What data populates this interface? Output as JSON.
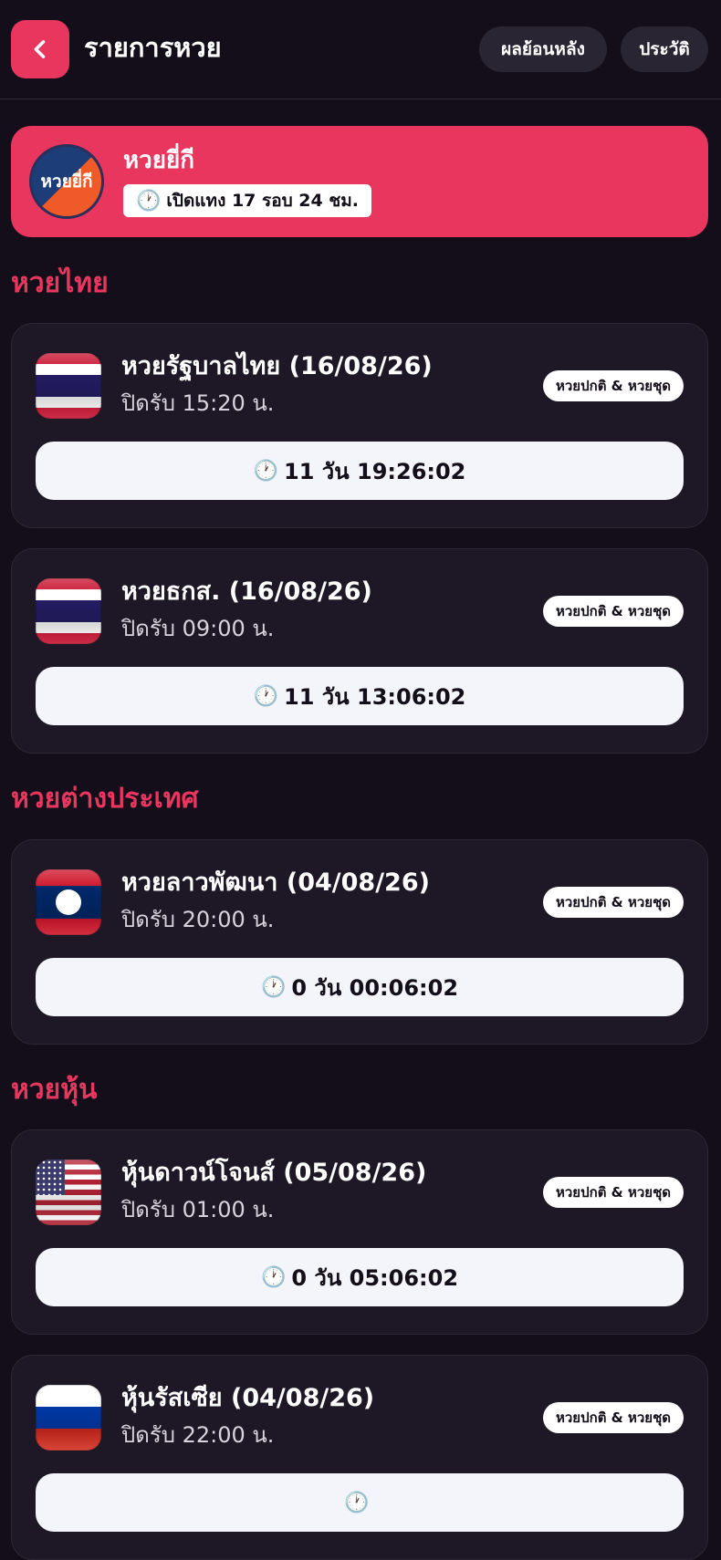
{
  "header": {
    "title": "รายการหวย",
    "results_history_label": "ผลย้อนหลัง",
    "history_label": "ประวัติ"
  },
  "featured": {
    "logo_text": "หวยยี่กี",
    "name": "หวยยี่กี",
    "badge": "เปิดแทง 17 รอบ 24 ชม."
  },
  "sections": [
    {
      "title": "หวยไทย",
      "cards": [
        {
          "name": "หวยรัฐบาลไทย (16/08/26)",
          "close": "ปิดรับ 15:20 น.",
          "tag": "หวยปกติ & หวยชุด",
          "countdown": "11 วัน 19:26:02",
          "flag": "thai-flag-icon"
        },
        {
          "name": "หวยธกส. (16/08/26)",
          "close": "ปิดรับ 09:00 น.",
          "tag": "หวยปกติ & หวยชุด",
          "countdown": "11 วัน 13:06:02",
          "flag": "thai-flag-icon"
        }
      ]
    },
    {
      "title": "หวยต่างประเทศ",
      "cards": [
        {
          "name": "หวยลาวพัฒนา (04/08/26)",
          "close": "ปิดรับ 20:00 น.",
          "tag": "หวยปกติ & หวยชุด",
          "countdown": "0 วัน 00:06:02",
          "flag": "lao-flag-icon"
        }
      ]
    },
    {
      "title": "หวยหุ้น",
      "cards": [
        {
          "name": "หุ้นดาวน์โจนส์ (05/08/26)",
          "close": "ปิดรับ 01:00 น.",
          "tag": "หวยปกติ & หวยชุด",
          "countdown": "0 วัน 05:06:02",
          "flag": "us-flag-icon"
        },
        {
          "name": "หุ้นรัสเซีย (04/08/26)",
          "close": "ปิดรับ 22:00 น.",
          "tag": "หวยปกติ & หวยชุด",
          "countdown": "",
          "flag": "russia-flag-icon"
        }
      ]
    }
  ],
  "colors": {
    "accent": "#e8365f",
    "background": "#130e19",
    "card": "#1d1726"
  }
}
